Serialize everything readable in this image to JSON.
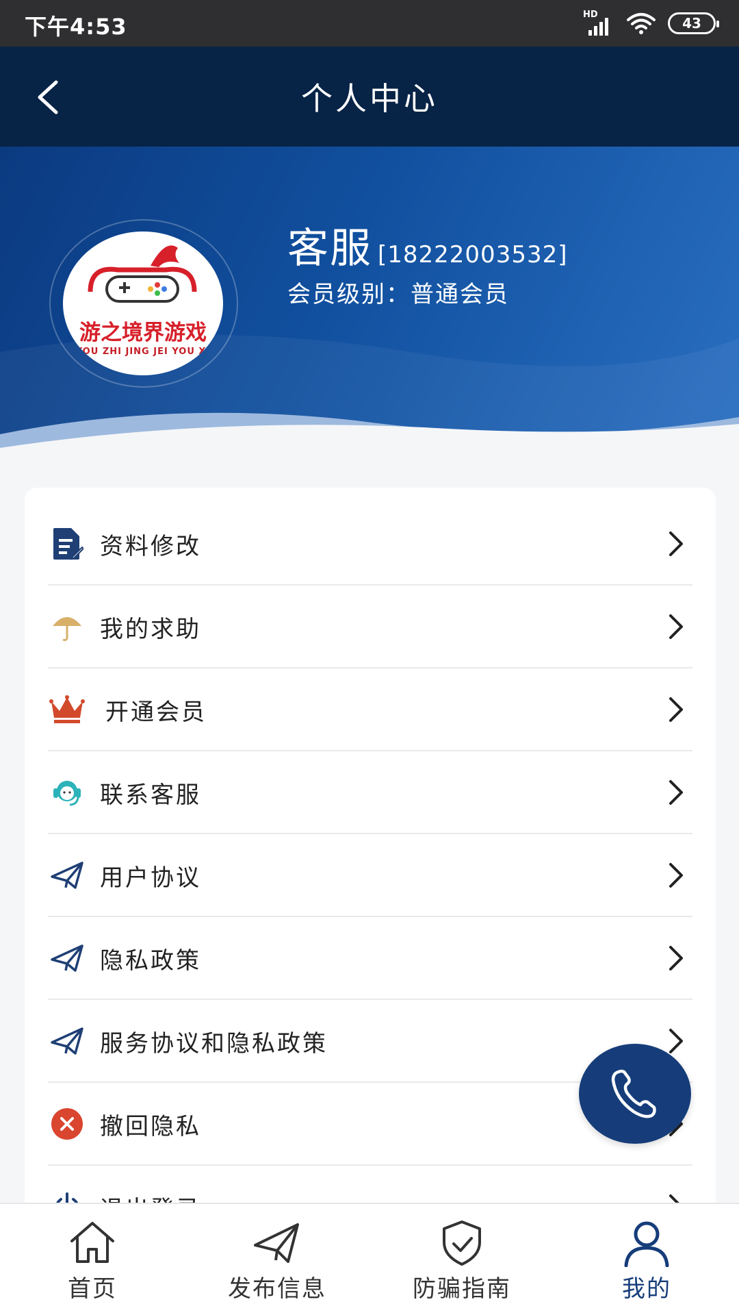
{
  "status_bar": {
    "time": "下午4:53",
    "network_label": "HD",
    "battery": "43"
  },
  "header": {
    "title": "个人中心"
  },
  "profile": {
    "name": "客服",
    "phone": "[18222003532]",
    "level": "会员级别：普通会员",
    "avatar_text_cn": "游之境界游戏",
    "avatar_text_en": "YOU ZHI JING JEI YOU XI"
  },
  "menu": {
    "items": [
      {
        "label": "资料修改",
        "icon": "edit-document-icon"
      },
      {
        "label": "我的求助",
        "icon": "umbrella-icon"
      },
      {
        "label": "开通会员",
        "icon": "crown-icon"
      },
      {
        "label": "联系客服",
        "icon": "customer-service-icon"
      },
      {
        "label": "用户协议",
        "icon": "paper-plane-icon"
      },
      {
        "label": "隐私政策",
        "icon": "paper-plane-icon"
      },
      {
        "label": "服务协议和隐私政策",
        "icon": "paper-plane-icon"
      },
      {
        "label": "撤回隐私",
        "icon": "close-circle-icon"
      },
      {
        "label": "退出登录",
        "icon": "power-icon"
      }
    ]
  },
  "tabbar": {
    "items": [
      {
        "label": "首页",
        "icon": "home-icon"
      },
      {
        "label": "发布信息",
        "icon": "paper-plane-icon"
      },
      {
        "label": "防骗指南",
        "icon": "shield-check-icon"
      },
      {
        "label": "我的",
        "icon": "user-icon"
      }
    ],
    "active_index": 3
  },
  "colors": {
    "navbar": "#072346",
    "accent": "#163d7a",
    "crown": "#d24a2b",
    "umbrella": "#d8b06a",
    "headset": "#2bb3b9",
    "close": "#d9452f"
  }
}
